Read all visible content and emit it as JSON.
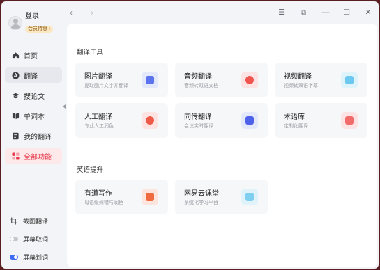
{
  "profile": {
    "login": "登录",
    "vip_badge": "会员特惠 ›"
  },
  "nav": [
    {
      "label": "首页",
      "icon": "home-icon"
    },
    {
      "label": "翻译",
      "icon": "translate-icon"
    },
    {
      "label": "搜论文",
      "icon": "graduation-cap-icon"
    },
    {
      "label": "单词本",
      "icon": "book-icon"
    },
    {
      "label": "我的翻译",
      "icon": "document-icon"
    },
    {
      "label": "全部功能",
      "icon": "grid-icon"
    }
  ],
  "tools": [
    {
      "label": "截图翻译",
      "icon": "crop-icon"
    },
    {
      "label": "屏幕取词",
      "toggle": "off"
    },
    {
      "label": "屏幕划词",
      "toggle": "on"
    }
  ],
  "window": {
    "back": "‹",
    "forward": "›",
    "menu": "☰",
    "mini": "⧉",
    "minimize": "—",
    "maximize": "☐",
    "close": "✕"
  },
  "sections": {
    "translate_tools": "翻译工具",
    "english_improve": "英语提升"
  },
  "cards": {
    "image": {
      "title": "图片翻译",
      "sub": "提取图片文字并翻译"
    },
    "audio": {
      "title": "音频翻译",
      "sub": "音频转双语文档"
    },
    "video": {
      "title": "视频翻译",
      "sub": "视频转双语字幕"
    },
    "human": {
      "title": "人工翻译",
      "sub": "专业人工润色"
    },
    "simul": {
      "title": "同传翻译",
      "sub": "会议实时翻译"
    },
    "term": {
      "title": "术语库",
      "sub": "定制化翻译"
    },
    "writing": {
      "title": "有道写作",
      "sub": "母语级纠错与润色"
    },
    "course": {
      "title": "网易云课堂",
      "sub": "系统化学习平台"
    }
  },
  "colors": {
    "accent_red": "#e8394a",
    "toggle_on": "#3d6cf5",
    "toggle_off": "#c4c6cc"
  }
}
